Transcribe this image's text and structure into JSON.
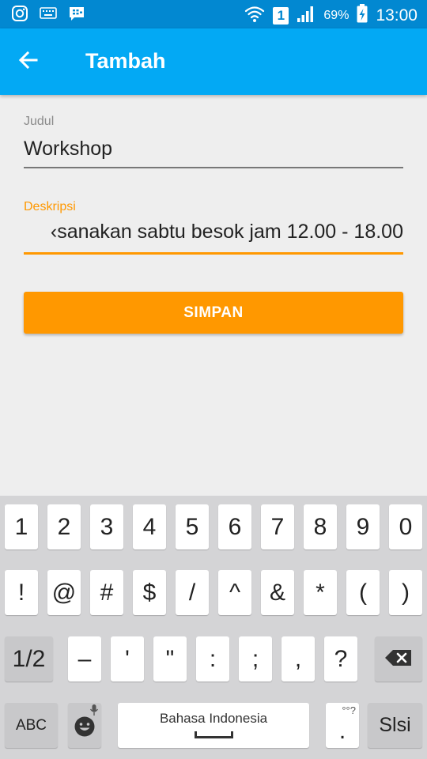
{
  "status_bar": {
    "battery": "69%",
    "sim": "1",
    "time": "13:00",
    "icons": [
      "instagram-icon",
      "keyboard-icon",
      "bbm-icon",
      "wifi-icon",
      "signal-icon",
      "battery-charging-icon"
    ]
  },
  "app_bar": {
    "title": "Tambah",
    "back_icon": "arrow-back-icon"
  },
  "form": {
    "title_label": "Judul",
    "title_value": "Workshop",
    "desc_label": "Deskripsi",
    "desc_value": "‹sanakan sabtu besok jam 12.00 - 18.00",
    "save_label": "SIMPAN"
  },
  "keyboard": {
    "row1": [
      "1",
      "2",
      "3",
      "4",
      "5",
      "6",
      "7",
      "8",
      "9",
      "0"
    ],
    "row2": [
      "!",
      "@",
      "#",
      "$",
      "/",
      "^",
      "&",
      "*",
      "(",
      ")"
    ],
    "row3_mode": "1/2",
    "row3": [
      "–",
      "'",
      "\"",
      ":",
      ";",
      ",",
      "?"
    ],
    "abc": "ABC",
    "space_label": "Bahasa Indonesia",
    "period_hint": "°°?",
    "period": ".",
    "enter": "Slsi",
    "mic_hint": "🎤",
    "emoji_icon": "emoji-icon",
    "backspace_icon": "backspace-icon"
  },
  "colors": {
    "status_bar": "#0288d1",
    "app_bar": "#03a9f4",
    "accent": "#ff9800"
  }
}
